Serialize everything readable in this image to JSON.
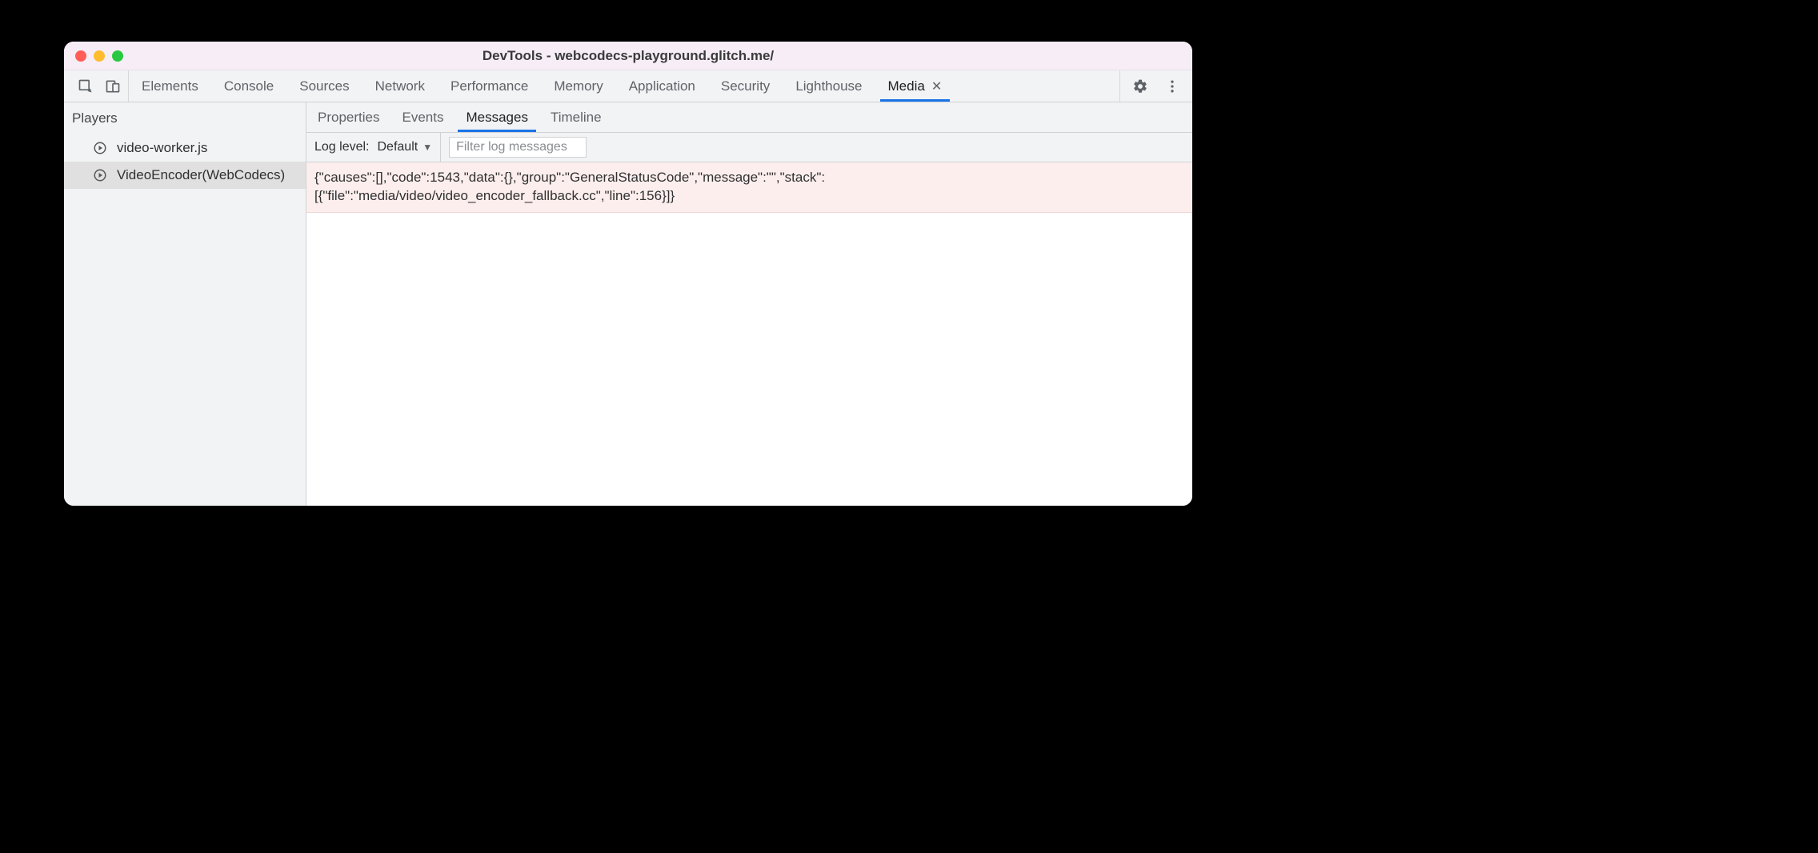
{
  "window": {
    "title": "DevTools - webcodecs-playground.glitch.me/"
  },
  "top_tabs": {
    "items": [
      {
        "label": "Elements",
        "active": false,
        "closeable": false
      },
      {
        "label": "Console",
        "active": false,
        "closeable": false
      },
      {
        "label": "Sources",
        "active": false,
        "closeable": false
      },
      {
        "label": "Network",
        "active": false,
        "closeable": false
      },
      {
        "label": "Performance",
        "active": false,
        "closeable": false
      },
      {
        "label": "Memory",
        "active": false,
        "closeable": false
      },
      {
        "label": "Application",
        "active": false,
        "closeable": false
      },
      {
        "label": "Security",
        "active": false,
        "closeable": false
      },
      {
        "label": "Lighthouse",
        "active": false,
        "closeable": false
      },
      {
        "label": "Media",
        "active": true,
        "closeable": true
      }
    ]
  },
  "sidebar": {
    "heading": "Players",
    "items": [
      {
        "label": "video-worker.js",
        "selected": false
      },
      {
        "label": "VideoEncoder(WebCodecs)",
        "selected": true
      }
    ]
  },
  "sub_tabs": {
    "items": [
      {
        "label": "Properties",
        "active": false
      },
      {
        "label": "Events",
        "active": false
      },
      {
        "label": "Messages",
        "active": true
      },
      {
        "label": "Timeline",
        "active": false
      }
    ]
  },
  "filter": {
    "log_level_label": "Log level:",
    "log_level_value": "Default",
    "placeholder": "Filter log messages",
    "value": ""
  },
  "messages": {
    "rows": [
      {
        "level": "error",
        "text": "{\"causes\":[],\"code\":1543,\"data\":{},\"group\":\"GeneralStatusCode\",\"message\":\"\",\"stack\":[{\"file\":\"media/video/video_encoder_fallback.cc\",\"line\":156}]}"
      }
    ]
  }
}
